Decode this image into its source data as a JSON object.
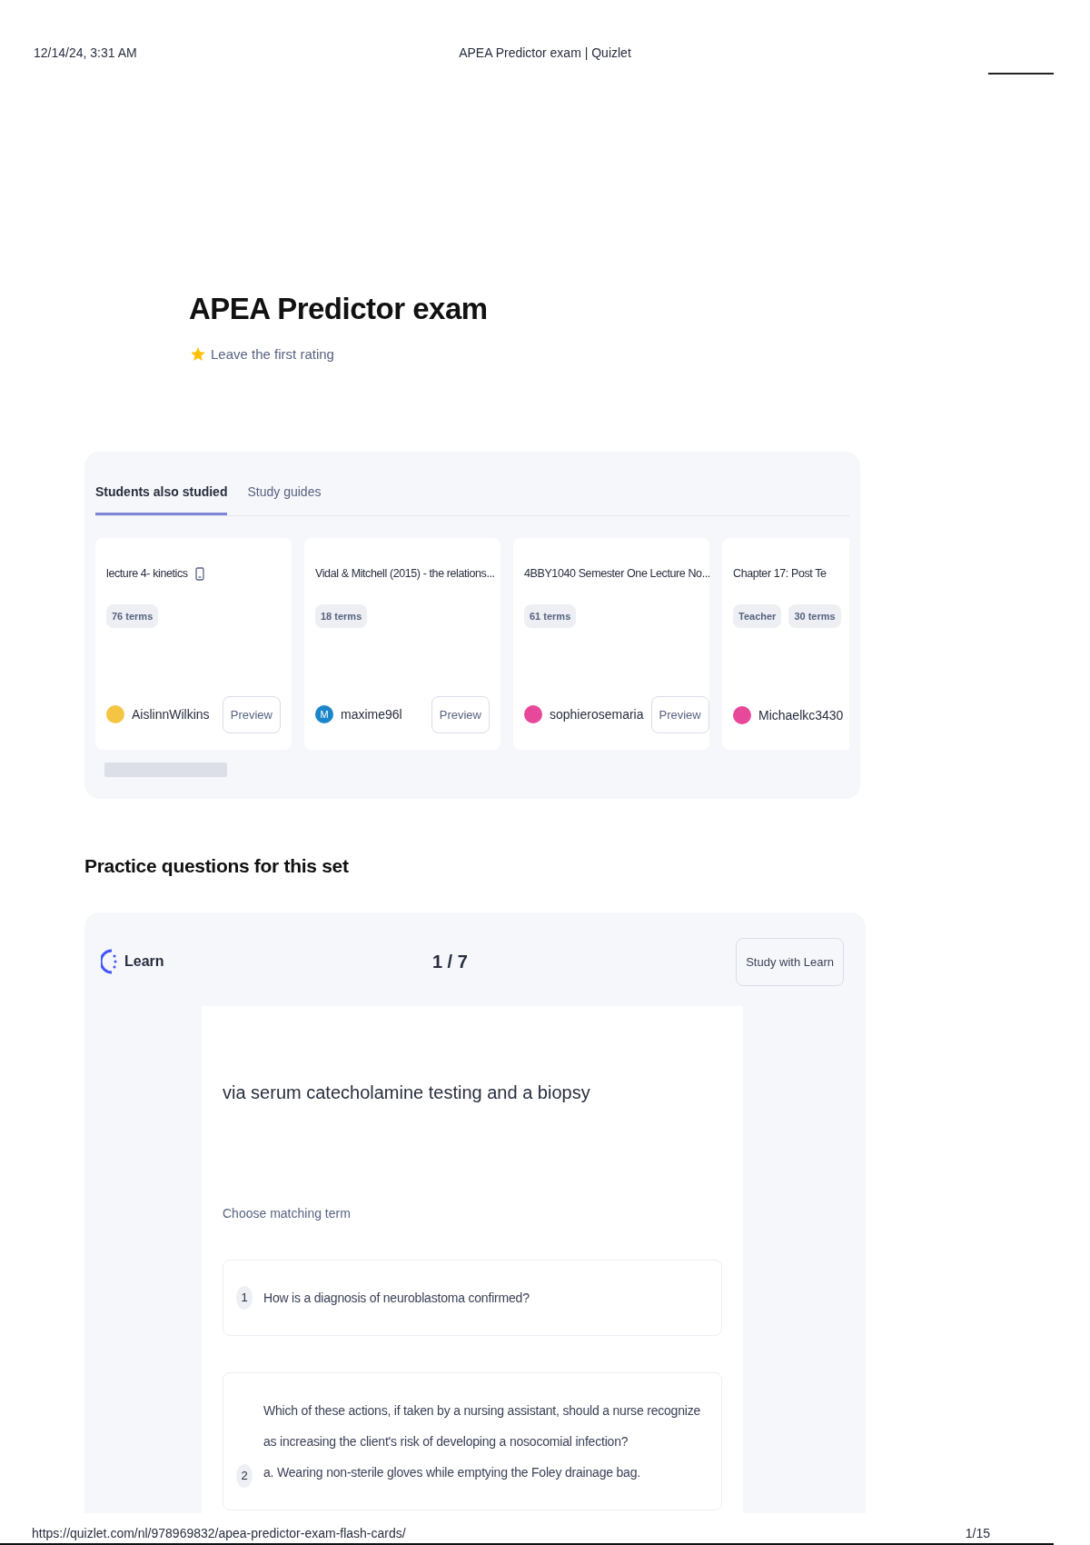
{
  "print_header": {
    "date": "12/14/24, 3:31 AM",
    "title": "APEA Predictor exam | Quizlet"
  },
  "set": {
    "title": "APEA Predictor exam",
    "rating": "Leave the first rating"
  },
  "tabs": [
    {
      "label": "Students also studied",
      "selected": true
    },
    {
      "label": "Study guides",
      "selected": false
    }
  ],
  "sets": [
    {
      "title": "lecture 4- kinetics",
      "device_icon": true,
      "tags": [
        "76 terms"
      ],
      "author": "AislinnWilkins",
      "avatar": {
        "color": "#f4c542"
      },
      "preview": "Preview"
    },
    {
      "title": "Vidal & Mitchell (2015) - the relations...",
      "tags": [
        "18 terms"
      ],
      "author": "maxime96l",
      "avatar": {
        "color": "#1b86c9",
        "initial": "M"
      },
      "preview": "Preview"
    },
    {
      "title": "4BBY1040 Semester One Lecture No...",
      "tags": [
        "61 terms"
      ],
      "author": "sophierosemaria",
      "avatar": {
        "color": "#e8489a"
      },
      "preview": "Preview"
    },
    {
      "title": "Chapter 17: Post Te",
      "tags": [
        "Teacher",
        "30 terms"
      ],
      "author": "Michaelkc3430",
      "avatar": {
        "color": "#e8489a"
      }
    }
  ],
  "practice": {
    "heading": "Practice questions for this set",
    "mode": "Learn",
    "progress": "1 / 7",
    "button": "Study with Learn",
    "prompt": "via serum catecholamine testing and a biopsy",
    "instruction": "Choose matching term",
    "options": [
      {
        "number": "1",
        "lines": [
          "How is a diagnosis of neuroblastoma confirmed?"
        ]
      },
      {
        "number": "2",
        "lines": [
          "Which of these actions, if taken by a nursing assistant, should a nurse recognize as increasing the client's risk of developing a nosocomial infection?",
          "a. Wearing non-sterile gloves while emptying the Foley drainage bag."
        ]
      }
    ]
  },
  "print_footer": {
    "url": "https://quizlet.com/nl/978969832/apea-predictor-exam-flash-cards/",
    "page": "1/15"
  }
}
